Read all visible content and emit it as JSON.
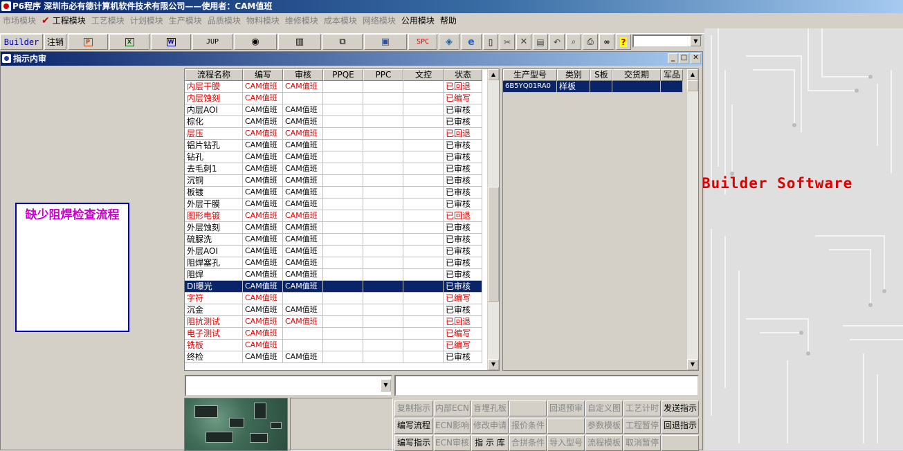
{
  "titlebar": {
    "title": "P6程序    深圳市必有德计算机软件技术有限公司——使用者：CAM值班"
  },
  "menu": [
    {
      "label": "市场模块",
      "enabled": false
    },
    {
      "label": "工程模块",
      "enabled": true,
      "checked": true
    },
    {
      "label": "工艺模块",
      "enabled": false
    },
    {
      "label": "计划模块",
      "enabled": false
    },
    {
      "label": "生产模块",
      "enabled": false
    },
    {
      "label": "品质模块",
      "enabled": false
    },
    {
      "label": "物料模块",
      "enabled": false
    },
    {
      "label": "维修模块",
      "enabled": false
    },
    {
      "label": "成本模块",
      "enabled": false
    },
    {
      "label": "网络模块",
      "enabled": false
    },
    {
      "label": "公用模块",
      "enabled": true
    },
    {
      "label": "帮助",
      "enabled": true
    }
  ],
  "toolbar": {
    "builder": "Builder",
    "logout": "注销",
    "jup": "JUP",
    "spc": "SPC"
  },
  "brand": {
    "text": "Builder Software"
  },
  "window": {
    "title": "指示内审"
  },
  "warning": {
    "text": "缺少阻焊检查流程"
  },
  "flow_grid": {
    "columns": [
      "流程名称",
      "编写",
      "审核",
      "PPQE",
      "PPC",
      "文控",
      "状态"
    ],
    "rows": [
      [
        "内层干膜",
        "CAM值班",
        "CAM值班",
        "",
        "",
        "",
        "已回退"
      ],
      [
        "内层蚀刻",
        "CAM值班",
        "",
        "",
        "",
        "",
        "已编写"
      ],
      [
        "内层AOI",
        "CAM值班",
        "CAM值班",
        "",
        "",
        "",
        "已审核"
      ],
      [
        "棕化",
        "CAM值班",
        "CAM值班",
        "",
        "",
        "",
        "已审核"
      ],
      [
        "层压",
        "CAM值班",
        "CAM值班",
        "",
        "",
        "",
        "已回退"
      ],
      [
        "铝片钻孔",
        "CAM值班",
        "CAM值班",
        "",
        "",
        "",
        "已审核"
      ],
      [
        "钻孔",
        "CAM值班",
        "CAM值班",
        "",
        "",
        "",
        "已审核"
      ],
      [
        "去毛刺1",
        "CAM值班",
        "CAM值班",
        "",
        "",
        "",
        "已审核"
      ],
      [
        "沉铜",
        "CAM值班",
        "CAM值班",
        "",
        "",
        "",
        "已审核"
      ],
      [
        "板镀",
        "CAM值班",
        "CAM值班",
        "",
        "",
        "",
        "已审核"
      ],
      [
        "外层干膜",
        "CAM值班",
        "CAM值班",
        "",
        "",
        "",
        "已审核"
      ],
      [
        "图形电镀",
        "CAM值班",
        "CAM值班",
        "",
        "",
        "",
        "已回退"
      ],
      [
        "外层蚀刻",
        "CAM值班",
        "CAM值班",
        "",
        "",
        "",
        "已审核"
      ],
      [
        "硫脲洗",
        "CAM值班",
        "CAM值班",
        "",
        "",
        "",
        "已审核"
      ],
      [
        "外层AOI",
        "CAM值班",
        "CAM值班",
        "",
        "",
        "",
        "已审核"
      ],
      [
        "阻焊塞孔",
        "CAM值班",
        "CAM值班",
        "",
        "",
        "",
        "已审核"
      ],
      [
        "阻焊",
        "CAM值班",
        "CAM值班",
        "",
        "",
        "",
        "已审核"
      ],
      [
        "DI曝光",
        "CAM值班",
        "CAM值班",
        "",
        "",
        "",
        "已审核"
      ],
      [
        "字符",
        "CAM值班",
        "",
        "",
        "",
        "",
        "已编写"
      ],
      [
        "沉金",
        "CAM值班",
        "CAM值班",
        "",
        "",
        "",
        "已审核"
      ],
      [
        "阻抗测试",
        "CAM值班",
        "CAM值班",
        "",
        "",
        "",
        "已回退"
      ],
      [
        "电子测试",
        "CAM值班",
        "",
        "",
        "",
        "",
        "已编写"
      ],
      [
        "铣板",
        "CAM值班",
        "",
        "",
        "",
        "",
        "已编写"
      ],
      [
        "终检",
        "CAM值班",
        "CAM值班",
        "",
        "",
        "",
        "已审核"
      ]
    ],
    "selected_index": 17,
    "red_status": [
      "已回退",
      "已编写"
    ]
  },
  "model_grid": {
    "columns": [
      "生产型号",
      "类别",
      "S板",
      "交货期",
      "军品"
    ],
    "rows": [
      [
        "6B5YQ01RA0",
        "样板",
        "",
        "",
        ""
      ]
    ]
  },
  "actions": [
    [
      "复制指示",
      "内部ECN",
      "盲埋孔板",
      "",
      "回退预审",
      "自定义图",
      "工艺计时",
      "发送指示"
    ],
    [
      "编写流程",
      "ECN影响",
      "修改申请",
      "报价条件",
      "",
      "参数模板",
      "工程暂停",
      "回退指示"
    ],
    [
      "编写指示",
      "ECN审核",
      "指 示 库",
      "合拼条件",
      "导入型号",
      "流程模板",
      "取消暂停",
      ""
    ]
  ],
  "actions_enabled": [
    [
      false,
      false,
      false,
      false,
      false,
      false,
      false,
      true
    ],
    [
      true,
      false,
      false,
      false,
      false,
      false,
      false,
      true
    ],
    [
      true,
      false,
      true,
      false,
      false,
      false,
      false,
      false
    ]
  ],
  "colors": {
    "title_start": "#0a246a",
    "title_end": "#a6caf0",
    "selection": "#0a246a",
    "status_red": "#e00000",
    "warning_text": "#cc00cc",
    "warning_border": "#0000cc"
  }
}
